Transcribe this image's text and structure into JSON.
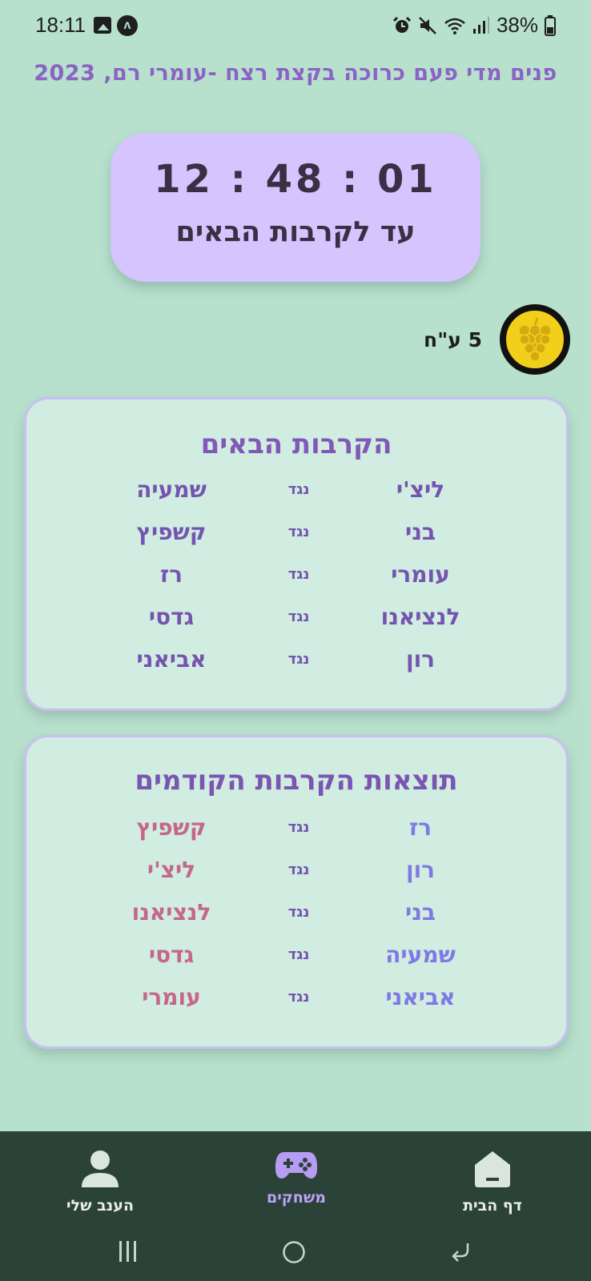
{
  "status_bar": {
    "time": "18:11",
    "battery": "38%",
    "icons": [
      "image-icon",
      "a-notification-icon",
      "alarm-icon",
      "mute-icon",
      "wifi-icon",
      "signal-icon",
      "battery-icon"
    ]
  },
  "header": {
    "title": "פנים מדי פעם כרוכה בקצת רצח -עומרי רם, 2023"
  },
  "countdown": {
    "time": "12 : 48 : 01",
    "label": "עד לקרבות הבאים"
  },
  "points": {
    "text": "5 ע\"ח",
    "icon": "grape-icon",
    "badge_color": "#f2cf1a"
  },
  "upcoming": {
    "title": "הקרבות הבאים",
    "matches": [
      {
        "a": "ליצ'י",
        "vs": "נגד",
        "b": "שמעיה"
      },
      {
        "a": "בני",
        "vs": "נגד",
        "b": "קשפיץ"
      },
      {
        "a": "עומרי",
        "vs": "נגד",
        "b": "רז"
      },
      {
        "a": "לנציאנו",
        "vs": "נגד",
        "b": "גדסי"
      },
      {
        "a": "רון",
        "vs": "נגד",
        "b": "אביאני"
      }
    ]
  },
  "previous": {
    "title": "תוצאות הקרבות הקודמים",
    "matches": [
      {
        "a": "רז",
        "vs": "נגד",
        "b": "קשפיץ"
      },
      {
        "a": "רון",
        "vs": "נגד",
        "b": "ליצ'י"
      },
      {
        "a": "בני",
        "vs": "נגד",
        "b": "לנציאנו"
      },
      {
        "a": "שמעיה",
        "vs": "נגד",
        "b": "גדסי"
      },
      {
        "a": "אביאני",
        "vs": "נגד",
        "b": "עומרי"
      }
    ],
    "colors": {
      "a": "#7f79e5",
      "b": "#c5668d"
    }
  },
  "nav": {
    "home": {
      "label": "דף הבית",
      "icon": "home-icon"
    },
    "players": {
      "label": "משחקים",
      "icon": "gamepad-icon"
    },
    "profile": {
      "label": "הענב שלי",
      "icon": "person-icon"
    }
  },
  "colors": {
    "background": "#b7e0cd",
    "accent": "#8b63c5",
    "countdown_bg": "#d5c4fd",
    "card_bg": "#d1ece0",
    "nav_bg": "#2b4239"
  }
}
